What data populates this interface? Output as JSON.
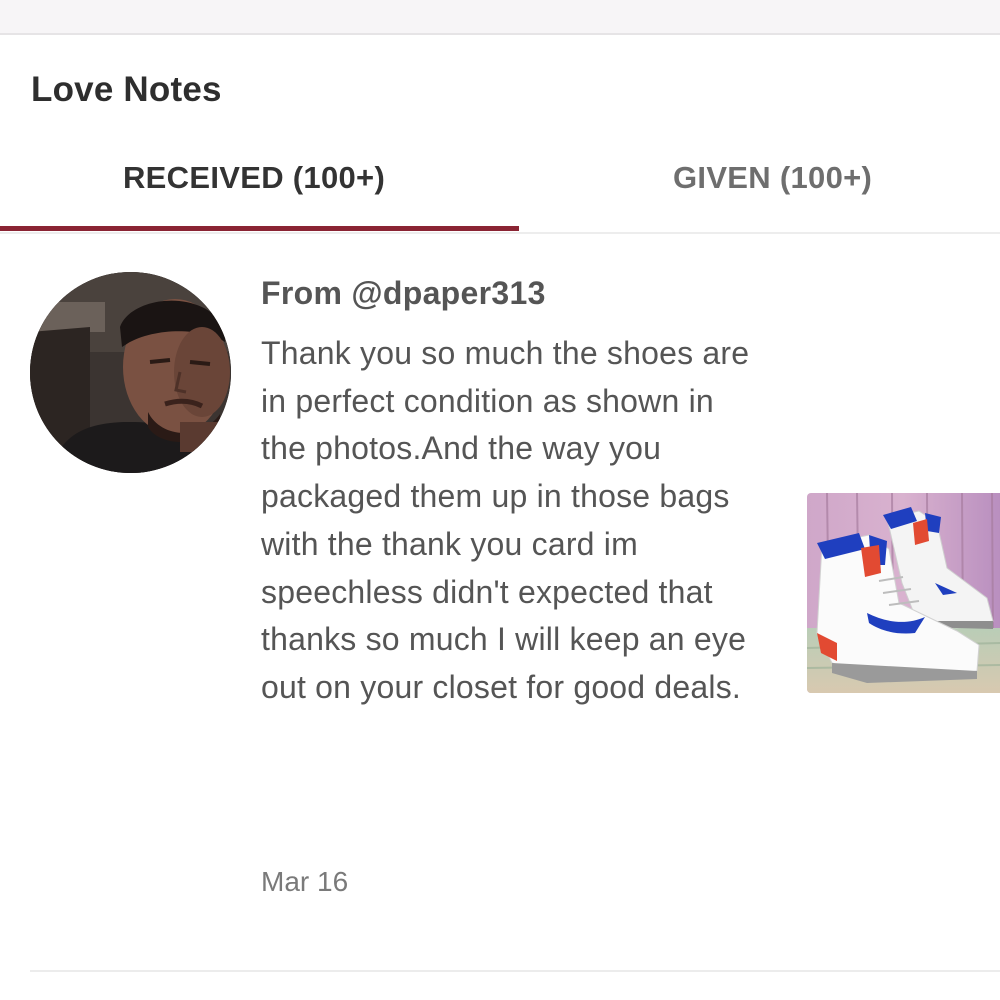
{
  "page": {
    "title": "Love Notes"
  },
  "tabs": [
    {
      "label": "RECEIVED (100+)",
      "active": true
    },
    {
      "label": "GIVEN (100+)",
      "active": false
    }
  ],
  "colors": {
    "accent": "#8a2433",
    "text_primary": "#333333",
    "text_secondary": "#555555",
    "text_muted": "#7a7a7a"
  },
  "note": {
    "from": "From @dpaper313",
    "message": "Thank you so much the shoes are in perfect condition as shown in the photos.And the way you packaged them up in those bags with the thank you card im speechless didn't expected that thanks so much I will keep an eye out on your closet for good deals.",
    "date": "Mar 16",
    "avatar": "user-avatar-photo",
    "photo": "sneakers-photo"
  }
}
